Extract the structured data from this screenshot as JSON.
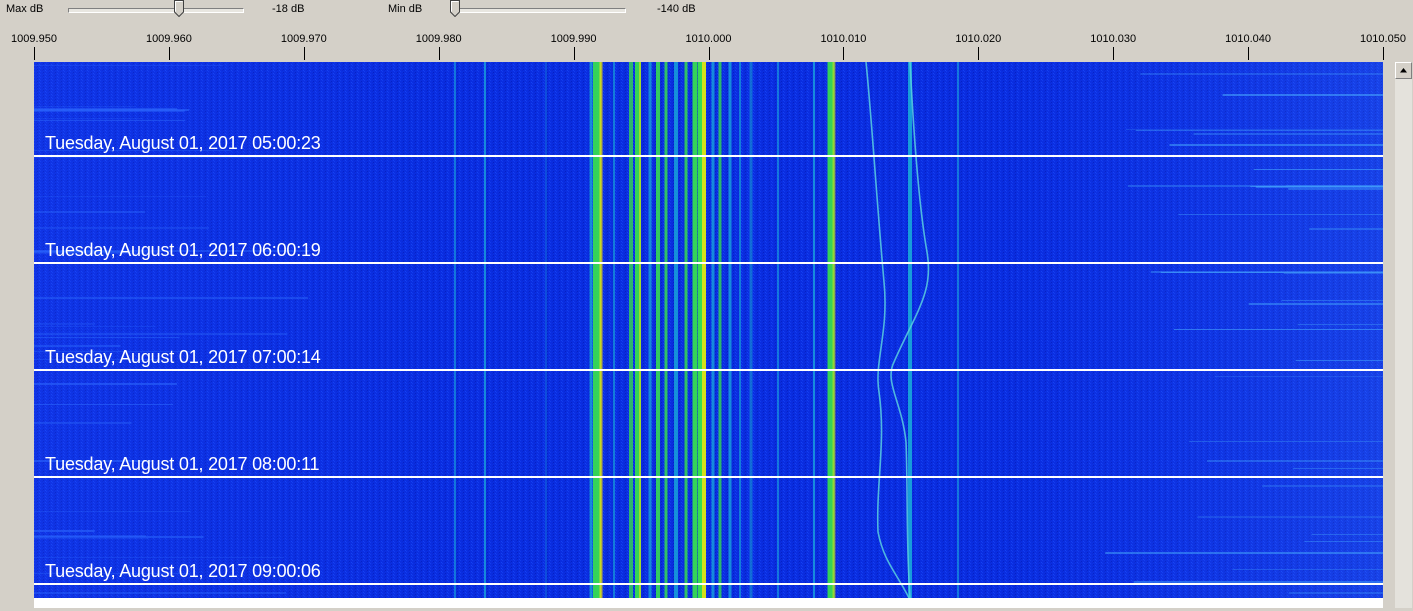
{
  "controls": {
    "max_db": {
      "label": "Max dB",
      "value_text": "-18 dB"
    },
    "min_db": {
      "label": "Min dB",
      "value_text": "-140 dB"
    }
  },
  "frequency_axis": {
    "ticks": [
      "1009.950",
      "1009.960",
      "1009.970",
      "1009.980",
      "1009.990",
      "1010.000",
      "1010.010",
      "1010.020",
      "1010.030",
      "1010.040",
      "1010.050"
    ]
  },
  "waterfall": {
    "colors": {
      "background": "#0a2de0",
      "mid": "#19b0d8",
      "strong": "#39e64a",
      "peak": "#f0e010",
      "marker_line": "#ffffff"
    },
    "time_markers": [
      "Tuesday, August 01, 2017 05:00:23",
      "Tuesday, August 01, 2017 06:00:19",
      "Tuesday, August 01, 2017 07:00:14",
      "Tuesday, August 01, 2017 08:00:11",
      "Tuesday, August 01, 2017 09:00:06"
    ]
  },
  "scrollbar": {
    "up_icon": "triangle-up-icon"
  }
}
